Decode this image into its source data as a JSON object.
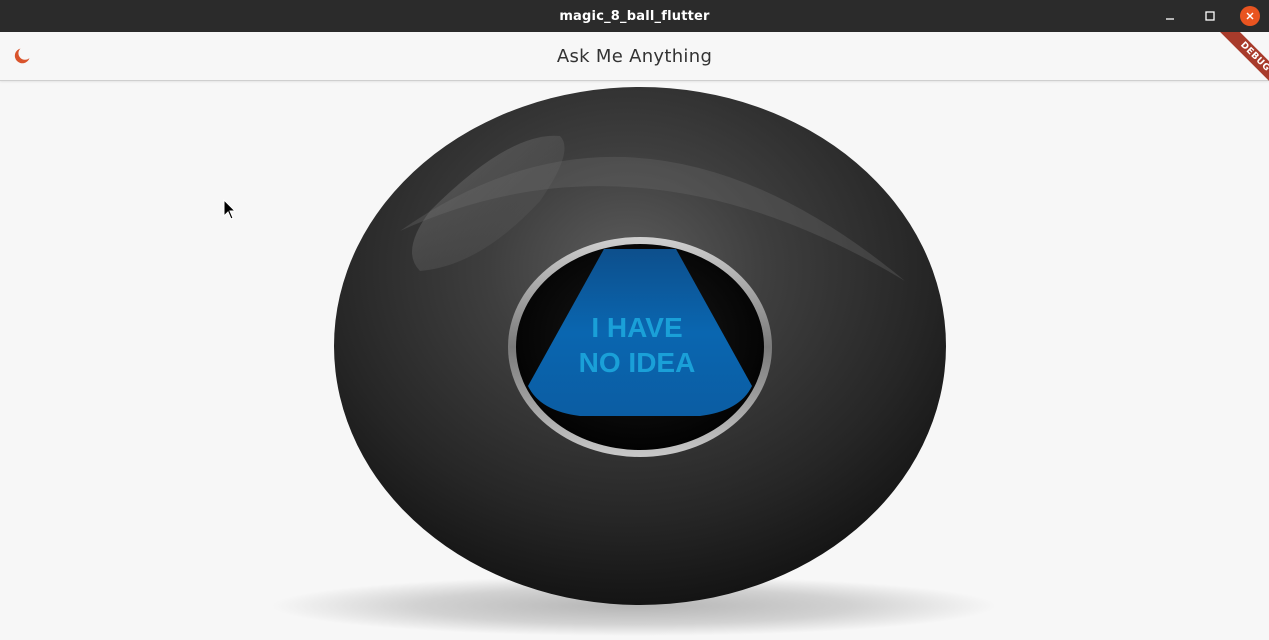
{
  "window": {
    "title": "magic_8_ball_flutter"
  },
  "appbar": {
    "title": "Ask Me Anything",
    "theme_icon": "moon-icon"
  },
  "debug_banner": {
    "label": "DEBUG"
  },
  "ball": {
    "answer_line1": "I HAVE",
    "answer_line2": "NO IDEA"
  },
  "colors": {
    "titlebar_bg": "#2b2b2b",
    "close_button": "#e95420",
    "accent_icon": "#d9542c",
    "debug_ribbon": "#a83b2b",
    "answer_text": "#1aa0d8",
    "triangle": "#0a63a8"
  }
}
